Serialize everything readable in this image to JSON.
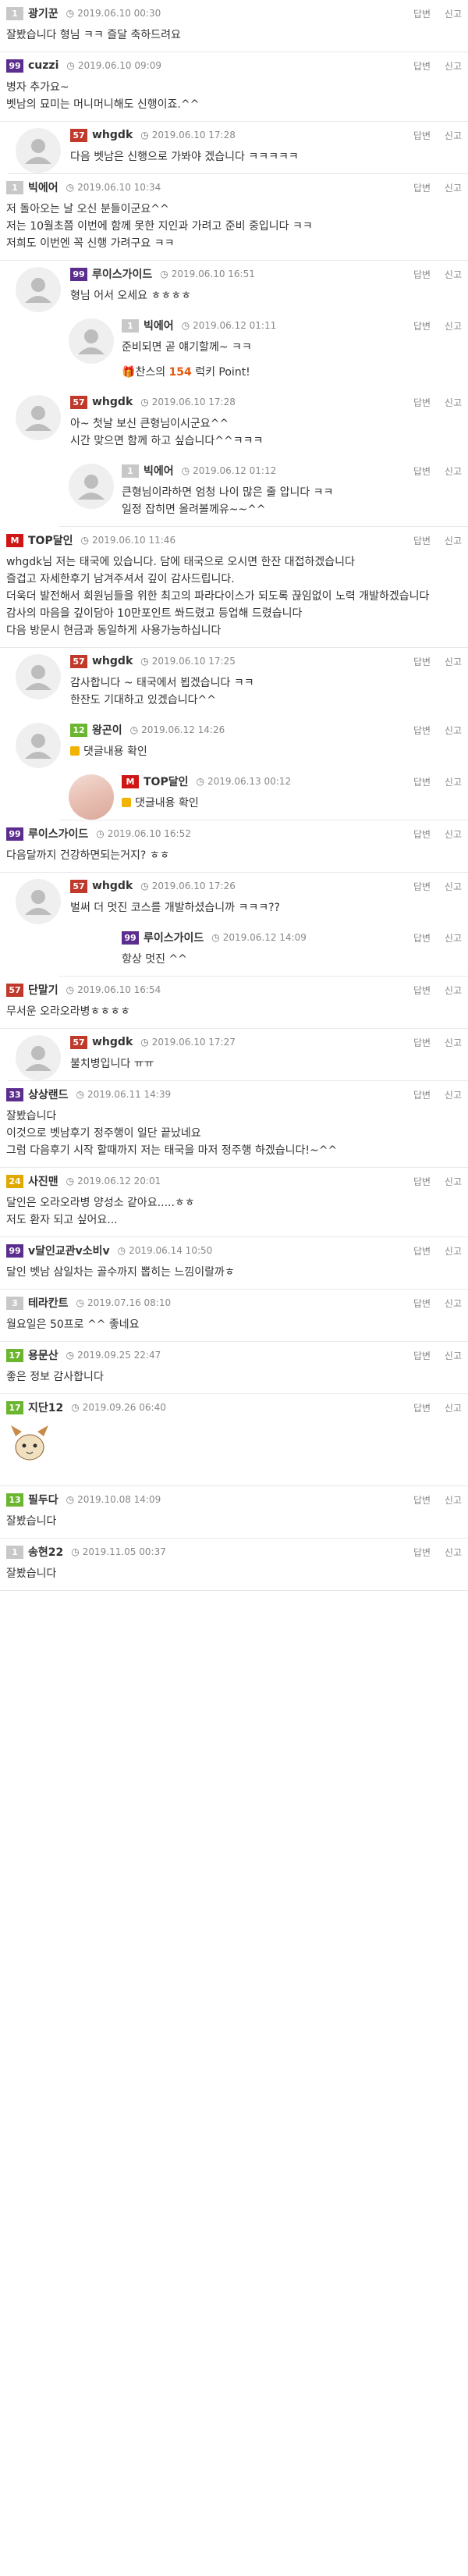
{
  "actions": {
    "reply": "답변",
    "report": "신고"
  },
  "comments": [
    {
      "indent": 1,
      "level": "1",
      "color": "#c8c8c8",
      "nick": "광기꾼",
      "date": "2019.06.10 00:30",
      "text": "잘봤습니다 형님 ㅋㅋ 즐달 축하드려요"
    },
    {
      "indent": 1,
      "level": "99",
      "color": "#5b2d8e",
      "nick": "cuzzi",
      "date": "2019.06.10 09:09",
      "text": "병자 추가요~\n벳남의 묘미는 머니머니해도 신행이죠.^^"
    },
    {
      "indent": 2,
      "level": "57",
      "color": "#c0392b",
      "nick": "whgdk",
      "date": "2019.06.10 17:28",
      "text": "다음 벳남은 신행으로 가봐야 겠습니다 ㅋㅋㅋㅋㅋ"
    },
    {
      "indent": 1,
      "level": "1",
      "color": "#c8c8c8",
      "nick": "빅에어",
      "date": "2019.06.10 10:34",
      "text": "저 돌아오는 날 오신 분들이군요^^\n저는 10월초쯤 이번에 함께 못한 지인과 가려고 준비 중입니다 ㅋㅋ\n저희도 이번엔 꼭 신행 가려구요 ㅋㅋ"
    },
    {
      "indent": 2,
      "level": "99",
      "color": "#5b2d8e",
      "nick": "루이스가이드",
      "date": "2019.06.10 16:51",
      "text": "형님 어서 오세요 ㅎㅎㅎㅎ"
    },
    {
      "indent": 3,
      "level": "1",
      "color": "#c8c8c8",
      "nick": "빅에어",
      "date": "2019.06.12 01:11",
      "text": "준비되면 곧 얘기할께~ ㅋㅋ",
      "point": {
        "prefix": "찬스의 ",
        "value": "154",
        "suffix": " 럭키 Point!"
      }
    },
    {
      "indent": 2,
      "level": "57",
      "color": "#c0392b",
      "nick": "whgdk",
      "date": "2019.06.10 17:28",
      "text": "아~ 첫날 보신 큰형님이시군요^^\n시간 맞으면 함께 하고 싶습니다^^ㅋㅋㅋ"
    },
    {
      "indent": 3,
      "level": "1",
      "color": "#c8c8c8",
      "nick": "빅에어",
      "date": "2019.06.12 01:12",
      "text": "큰형님이라하면 엄청 나이 많은 줄 압니다 ㅋㅋ\n일정 잡히면 올려볼께유~~^^"
    },
    {
      "indent": 1,
      "level": "M",
      "color": "#d01515",
      "nick": "TOP달인",
      "date": "2019.06.10 11:46",
      "text": "whgdk님 저는 태국에 있습니다. 담에 태국으로 오시면 한잔 대접하겠습니다\n즐겁고 자세한후기 남겨주셔서 깊이 감사드립니다.\n더욱더 발전해서 회원님들을 위한 최고의 파라다이스가 되도록 끊임없이 노력 개발하겠습니다\n감사의 마음을 깊이담아 10만포인트 쏴드렸고 등업해 드렸습니다\n다음 방문시 현금과 동일하게 사용가능하십니다"
    },
    {
      "indent": 2,
      "level": "57",
      "color": "#c0392b",
      "nick": "whgdk",
      "date": "2019.06.10 17:25",
      "text": "감사합니다 ~ 태국에서 뵙겠습니다 ㅋㅋ\n한잔도 기대하고 있겠습니다^^"
    },
    {
      "indent": 2,
      "level": "12",
      "color": "#6bb52f",
      "nick": "왕곤이",
      "date": "2019.06.12 14:26",
      "text": "댓글내용 확인",
      "lock": true
    },
    {
      "indent": 3,
      "level": "M",
      "color": "#d01515",
      "nick": "TOP달인",
      "date": "2019.06.13 00:12",
      "text": "댓글내용 확인",
      "lock": true,
      "photo": true
    },
    {
      "indent": 1,
      "level": "99",
      "color": "#5b2d8e",
      "nick": "루이스가이드",
      "date": "2019.06.10 16:52",
      "text": "다음달까지 건강하면되는거지? ㅎㅎ"
    },
    {
      "indent": 2,
      "level": "57",
      "color": "#c0392b",
      "nick": "whgdk",
      "date": "2019.06.10 17:26",
      "text": "벌써 더 멋진 코스를 개발하셨습니까 ㅋㅋㅋ??"
    },
    {
      "indent": 3,
      "level": "99",
      "color": "#5b2d8e",
      "nick": "루이스가이드",
      "date": "2019.06.12 14:09",
      "text": "항상 멋진 ^^",
      "noavatar": true
    },
    {
      "indent": 1,
      "level": "57",
      "color": "#c0392b",
      "nick": "단말기",
      "date": "2019.06.10 16:54",
      "text": "무서운 오라오라병ㅎㅎㅎㅎ"
    },
    {
      "indent": 2,
      "level": "57",
      "color": "#c0392b",
      "nick": "whgdk",
      "date": "2019.06.10 17:27",
      "text": "불치병입니다 ㅠㅠ"
    },
    {
      "indent": 1,
      "level": "33",
      "color": "#5b2d8e",
      "nick": "상상랜드",
      "date": "2019.06.11 14:39",
      "text": "잘봤습니다\n이것으로 벳남후기 정주행이 일단 끝났네요\n그럼 다음후기 시작 할때까지 저는 태국을 마저 정주행 하겠습니다!~^^"
    },
    {
      "indent": 1,
      "level": "24",
      "color": "#e0a800",
      "nick": "사진맨",
      "date": "2019.06.12 20:01",
      "text": "달인은 오라오라병 양성소 같아요.....ㅎㅎ\n저도 환자 되고 싶어요..."
    },
    {
      "indent": 1,
      "level": "99",
      "color": "#5b2d8e",
      "nick": "v달인교관v소비v",
      "date": "2019.06.14 10:50",
      "text": "달인 벳남 삼일차는 골수까지 뽑히는 느낌이랄까ㅎ"
    },
    {
      "indent": 1,
      "level": "3",
      "color": "#c8c8c8",
      "nick": "테라칸트",
      "date": "2019.07.16 08:10",
      "text": "월요일은 50프로 ^^ 좋네요"
    },
    {
      "indent": 1,
      "level": "17",
      "color": "#6bb52f",
      "nick": "용문산",
      "date": "2019.09.25 22:47",
      "text": "좋은 정보 감사합니다"
    },
    {
      "indent": 1,
      "level": "17",
      "color": "#6bb52f",
      "nick": "지단12",
      "date": "2019.09.26 06:40",
      "text": "",
      "deco": true
    },
    {
      "indent": 1,
      "level": "13",
      "color": "#6bb52f",
      "nick": "필두다",
      "date": "2019.10.08 14:09",
      "text": "잘봤습니다"
    },
    {
      "indent": 1,
      "level": "1",
      "color": "#c8c8c8",
      "nick": "송현22",
      "date": "2019.11.05 00:37",
      "text": "잘봤습니다"
    }
  ]
}
